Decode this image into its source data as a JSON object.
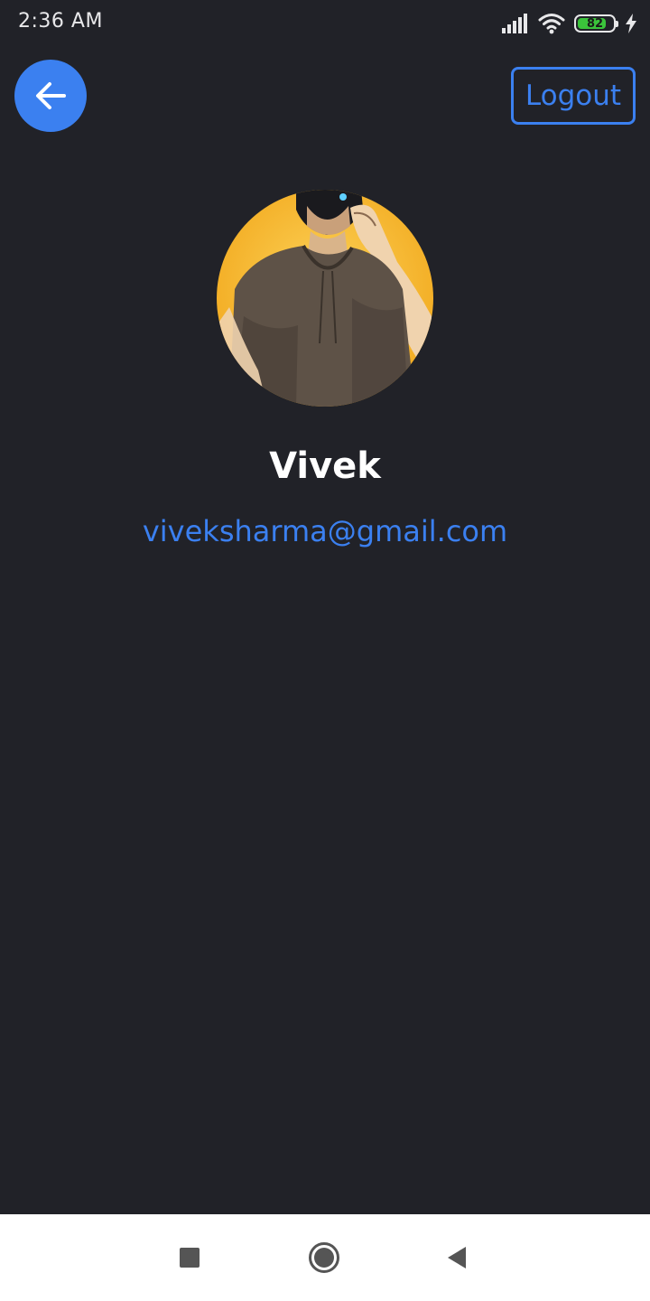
{
  "status_bar": {
    "time": "2:36 AM",
    "battery_level": 82,
    "battery_text": "82",
    "icons": [
      "signal-icon",
      "wifi-icon",
      "battery-icon",
      "charging-icon"
    ]
  },
  "header": {
    "back_icon": "arrow-left-icon",
    "logout_label": "Logout"
  },
  "profile": {
    "name": "Vivek",
    "email": "viveksharma@gmail.com",
    "avatar": "anime-character-avatar"
  },
  "nav_bar": {
    "icons": [
      "recents-square-icon",
      "home-circle-icon",
      "back-triangle-icon"
    ]
  },
  "colors": {
    "background": "#212228",
    "accent": "#3b80f0",
    "name_text": "#ffffff",
    "nav_background": "#ffffff",
    "battery_fill": "#3bc43b"
  }
}
